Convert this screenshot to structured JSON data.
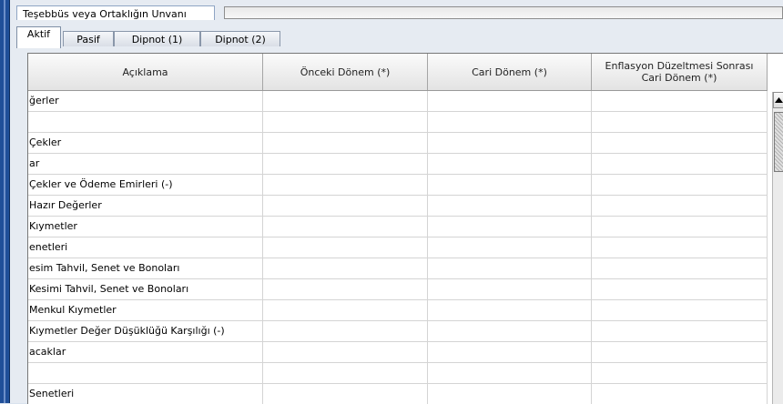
{
  "header": {
    "title_label": "Teşebbüs veya Ortaklığın Unvanı",
    "title_value": ""
  },
  "tabs": [
    {
      "label": "Aktif",
      "active": true
    },
    {
      "label": "Pasif",
      "active": false
    },
    {
      "label": "Dipnot (1)",
      "active": false
    },
    {
      "label": "Dipnot (2)",
      "active": false
    }
  ],
  "table": {
    "columns": [
      {
        "label": "Açıklama"
      },
      {
        "label": "Önceki Dönem (*)"
      },
      {
        "label": "Cari Dönem (*)"
      },
      {
        "label_line1": "Enflasyon Düzeltmesi Sonrası",
        "label_line2": "Cari Dönem (*)"
      }
    ],
    "rows": [
      {
        "desc": "ğerler",
        "prev": "",
        "curr": "",
        "infl": ""
      },
      {
        "desc": "",
        "prev": "",
        "curr": "",
        "infl": ""
      },
      {
        "desc": "Çekler",
        "prev": "",
        "curr": "",
        "infl": ""
      },
      {
        "desc": "ar",
        "prev": "",
        "curr": "",
        "infl": ""
      },
      {
        "desc": " Çekler ve Ödeme Emirleri (-)",
        "prev": "",
        "curr": "",
        "infl": ""
      },
      {
        "desc": "Hazır Değerler",
        "prev": "",
        "curr": "",
        "infl": ""
      },
      {
        "desc": "Kıymetler",
        "prev": "",
        "curr": "",
        "infl": ""
      },
      {
        "desc": "enetleri",
        "prev": "",
        "curr": "",
        "infl": ""
      },
      {
        "desc": "esim Tahvil, Senet ve Bonoları",
        "prev": "",
        "curr": "",
        "infl": ""
      },
      {
        "desc": "Kesimi Tahvil, Senet ve Bonoları",
        "prev": "",
        "curr": "",
        "infl": ""
      },
      {
        "desc": "Menkul Kıymetler",
        "prev": "",
        "curr": "",
        "infl": ""
      },
      {
        "desc": " Kıymetler Değer Düşüklüğü Karşılığı (-)",
        "prev": "",
        "curr": "",
        "infl": ""
      },
      {
        "desc": "acaklar",
        "prev": "",
        "curr": "",
        "infl": ""
      },
      {
        "desc": "",
        "prev": "",
        "curr": "",
        "infl": ""
      },
      {
        "desc": " Senetleri",
        "prev": "",
        "curr": "",
        "infl": ""
      }
    ]
  }
}
